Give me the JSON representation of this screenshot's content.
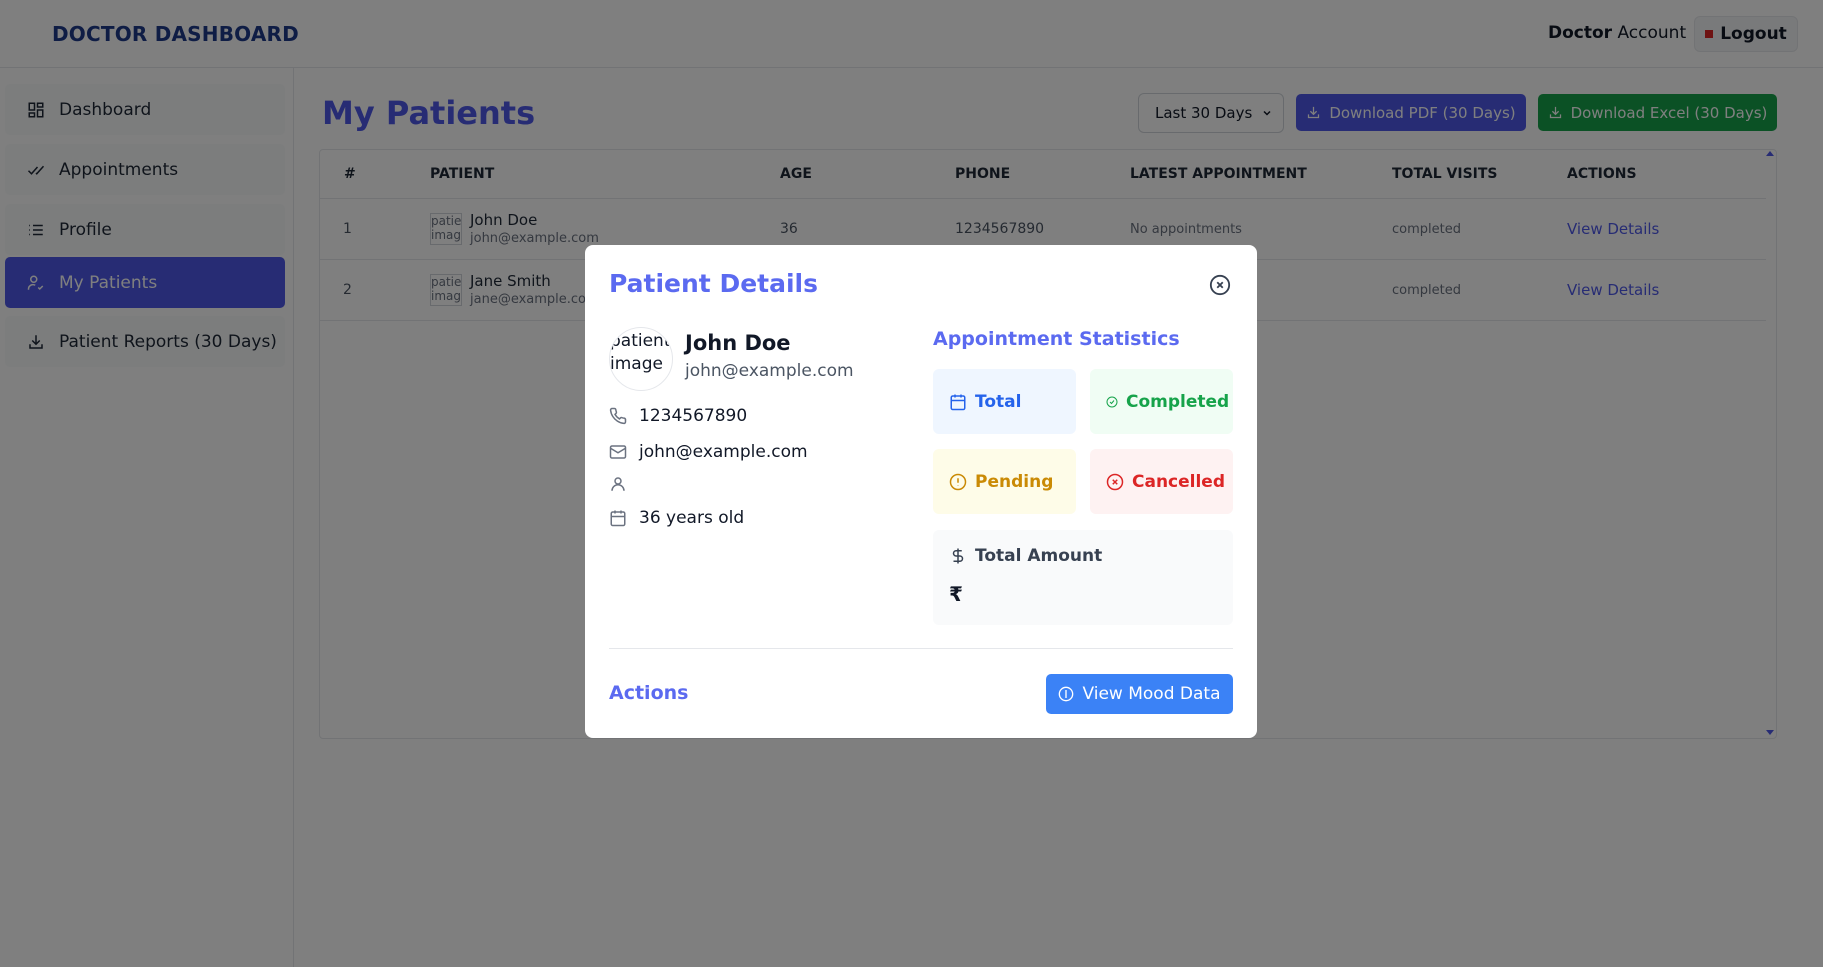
{
  "header": {
    "brand": "DOCTOR DASHBOARD",
    "account_bold": "Doctor",
    "account_rest": " Account",
    "logout_label": "Logout"
  },
  "sidebar": {
    "items": [
      {
        "label": "Dashboard",
        "icon": "grid-icon"
      },
      {
        "label": "Appointments",
        "icon": "double-check-icon"
      },
      {
        "label": "Profile",
        "icon": "list-icon"
      },
      {
        "label": "My Patients",
        "icon": "user-check-icon",
        "active": true
      },
      {
        "label": "Patient Reports (30 Days)",
        "icon": "download-icon"
      }
    ]
  },
  "main": {
    "title": "My Patients",
    "range_select": {
      "selected": "Last 30 Days"
    },
    "download_pdf_label": "Download PDF (30 Days)",
    "download_excel_label": "Download Excel (30 Days)",
    "table": {
      "headers": [
        "#",
        "PATIENT",
        "AGE",
        "PHONE",
        "LATEST APPOINTMENT",
        "TOTAL VISITS",
        "ACTIONS"
      ],
      "rows": [
        {
          "num": "1",
          "image_alt": "patient image",
          "name": "John Doe",
          "email": "john@example.com",
          "age": "36",
          "phone": "1234567890",
          "latest": "No appointments",
          "visits": "completed",
          "action": "View Details"
        },
        {
          "num": "2",
          "image_alt": "patient image",
          "name": "Jane Smith",
          "email": "jane@example.com",
          "visits": "completed",
          "action": "View Details"
        }
      ]
    }
  },
  "modal": {
    "title": "Patient Details",
    "avatar_alt": "patient image",
    "name": "John Doe",
    "email": "john@example.com",
    "phone": "1234567890",
    "contact_email": "john@example.com",
    "gender": "",
    "age_text": "36 years old",
    "stats_title": "Appointment Statistics",
    "stats": {
      "total": "Total",
      "completed": "Completed",
      "pending": "Pending",
      "cancelled": "Cancelled"
    },
    "amount_label": "Total Amount",
    "amount_value": "₹",
    "actions_label": "Actions",
    "mood_button_label": "View Mood Data"
  },
  "colors": {
    "primary": "#4f59e8",
    "success": "#16a34a",
    "brand": "#1e3a8a",
    "mood_button": "#3b82f6"
  }
}
